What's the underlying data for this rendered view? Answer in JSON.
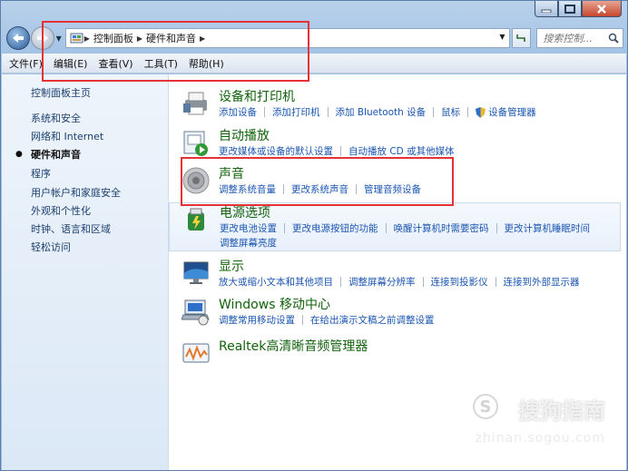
{
  "window": {
    "controls": {
      "minimize": "minimize",
      "maximize": "maximize",
      "close": "close"
    }
  },
  "address": {
    "crumbs": [
      "控制面板",
      "硬件和声音"
    ],
    "search_placeholder": "搜索控制..."
  },
  "menubar": {
    "items": [
      "文件(F)",
      "编辑(E)",
      "查看(V)",
      "工具(T)",
      "帮助(H)"
    ]
  },
  "sidebar": {
    "items": [
      {
        "label": "控制面板主页"
      },
      {
        "label": "系统和安全"
      },
      {
        "label": "网络和 Internet"
      },
      {
        "label": "硬件和声音",
        "active": true
      },
      {
        "label": "程序"
      },
      {
        "label": "用户帐户和家庭安全"
      },
      {
        "label": "外观和个性化"
      },
      {
        "label": "时钟、语言和区域"
      },
      {
        "label": "轻松访问"
      }
    ]
  },
  "categories": [
    {
      "title": "设备和打印机",
      "icon": "printer-icon",
      "links": [
        "添加设备",
        "添加打印机",
        "添加 Bluetooth 设备",
        "鼠标",
        "设备管理器"
      ]
    },
    {
      "title": "自动播放",
      "icon": "autoplay-icon",
      "links": [
        "更改媒体或设备的默认设置",
        "自动播放 CD 或其他媒体"
      ]
    },
    {
      "title": "声音",
      "icon": "speaker-icon",
      "links": [
        "调整系统音量",
        "更改系统声音",
        "管理音频设备"
      ]
    },
    {
      "title": "电源选项",
      "icon": "power-icon",
      "links": [
        "更改电池设置",
        "更改电源按钮的功能",
        "唤醒计算机时需要密码",
        "更改计算机睡眠时间"
      ],
      "links2": [
        "调整屏幕亮度"
      ]
    },
    {
      "title": "显示",
      "icon": "display-icon",
      "links": [
        "放大或缩小文本和其他项目",
        "调整屏幕分辨率",
        "连接到投影仪",
        "连接到外部显示器"
      ]
    },
    {
      "title": "Windows 移动中心",
      "icon": "mobility-center-icon",
      "links": [
        "调整常用移动设置",
        "在给出演示文稿之前调整设置"
      ]
    },
    {
      "title": "Realtek高清晰音频管理器",
      "icon": "realtek-audio-icon",
      "links": []
    }
  ],
  "watermark": {
    "brand": "搜狗指南",
    "url": "zhinan.sogou.com"
  },
  "colors": {
    "link": "#1a55b0",
    "category_title": "#12620c",
    "annotation": "#e53237"
  }
}
